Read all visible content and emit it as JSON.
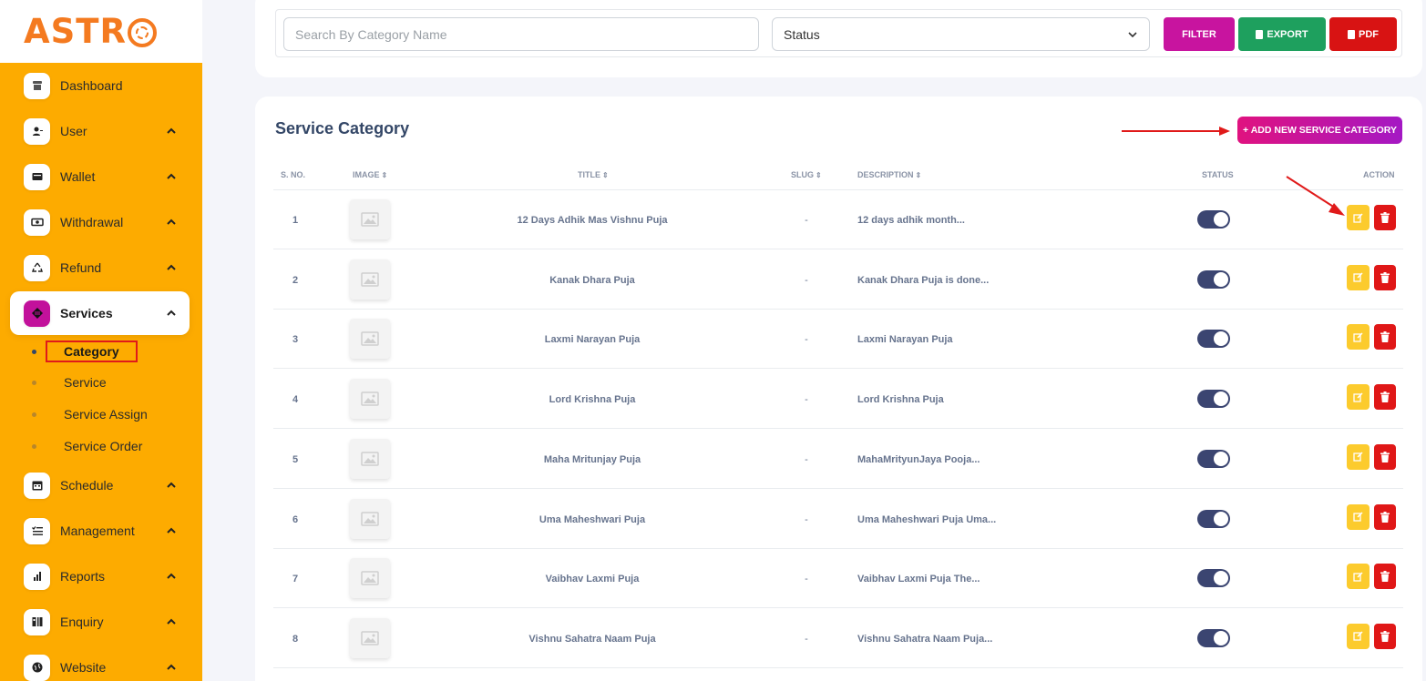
{
  "brand": {
    "logo_text": "ASTR"
  },
  "sidebar": {
    "items": [
      {
        "label": "Dashboard",
        "icon": "store-icon"
      },
      {
        "label": "User",
        "icon": "user-icon"
      },
      {
        "label": "Wallet",
        "icon": "wallet-icon"
      },
      {
        "label": "Withdrawal",
        "icon": "money-icon"
      },
      {
        "label": "Refund",
        "icon": "recycle-icon"
      },
      {
        "label": "Services",
        "icon": "layers-icon"
      },
      {
        "label": "Schedule",
        "icon": "calendar-icon"
      },
      {
        "label": "Management",
        "icon": "list-check-icon"
      },
      {
        "label": "Reports",
        "icon": "bar-chart-icon"
      },
      {
        "label": "Enquiry",
        "icon": "enquiry-icon"
      },
      {
        "label": "Website",
        "icon": "globe-icon"
      }
    ],
    "services_sub": [
      {
        "label": "Category"
      },
      {
        "label": "Service"
      },
      {
        "label": "Service Assign"
      },
      {
        "label": "Service Order"
      }
    ]
  },
  "filters": {
    "search_placeholder": "Search By Category Name",
    "status_value": "Status",
    "filter_label": "FILTER",
    "export_label": "EXPORT",
    "pdf_label": "PDF"
  },
  "card": {
    "title": "Service Category",
    "add_label": "+ ADD NEW SERVICE CATEGORY"
  },
  "table": {
    "headers": {
      "sno": "S. NO.",
      "image": "IMAGE",
      "title": "TITLE",
      "slug": "SLUG",
      "description": "DESCRIPTION",
      "status": "STATUS",
      "action": "ACTION"
    },
    "rows": [
      {
        "sno": "1",
        "title": "12 Days Adhik Mas Vishnu Puja",
        "slug": "-",
        "description": "12 days adhik month..."
      },
      {
        "sno": "2",
        "title": "Kanak Dhara Puja",
        "slug": "-",
        "description": "Kanak Dhara Puja is done..."
      },
      {
        "sno": "3",
        "title": "Laxmi Narayan Puja",
        "slug": "-",
        "description": "Laxmi Narayan Puja"
      },
      {
        "sno": "4",
        "title": "Lord Krishna Puja",
        "slug": "-",
        "description": "Lord Krishna Puja"
      },
      {
        "sno": "5",
        "title": "Maha Mritunjay Puja",
        "slug": "-",
        "description": "MahaMrityunJaya Pooja..."
      },
      {
        "sno": "6",
        "title": "Uma Maheshwari Puja",
        "slug": "-",
        "description": "Uma Maheshwari Puja Uma..."
      },
      {
        "sno": "7",
        "title": "Vaibhav Laxmi Puja",
        "slug": "-",
        "description": "Vaibhav Laxmi Puja The..."
      },
      {
        "sno": "8",
        "title": "Vishnu Sahatra Naam Puja",
        "slug": "-",
        "description": "Vishnu Sahatra Naam Puja..."
      }
    ]
  },
  "colors": {
    "sidebar_bg": "#fdab00",
    "brand_orange": "#f47a20",
    "filter_btn": "#c8149f",
    "export_btn": "#1ea05e",
    "pdf_btn": "#d81313",
    "edit_btn": "#fccb2d",
    "delete_btn": "#e01717",
    "toggle_on": "#3b4571",
    "annotation_red": "#e01a1a"
  }
}
